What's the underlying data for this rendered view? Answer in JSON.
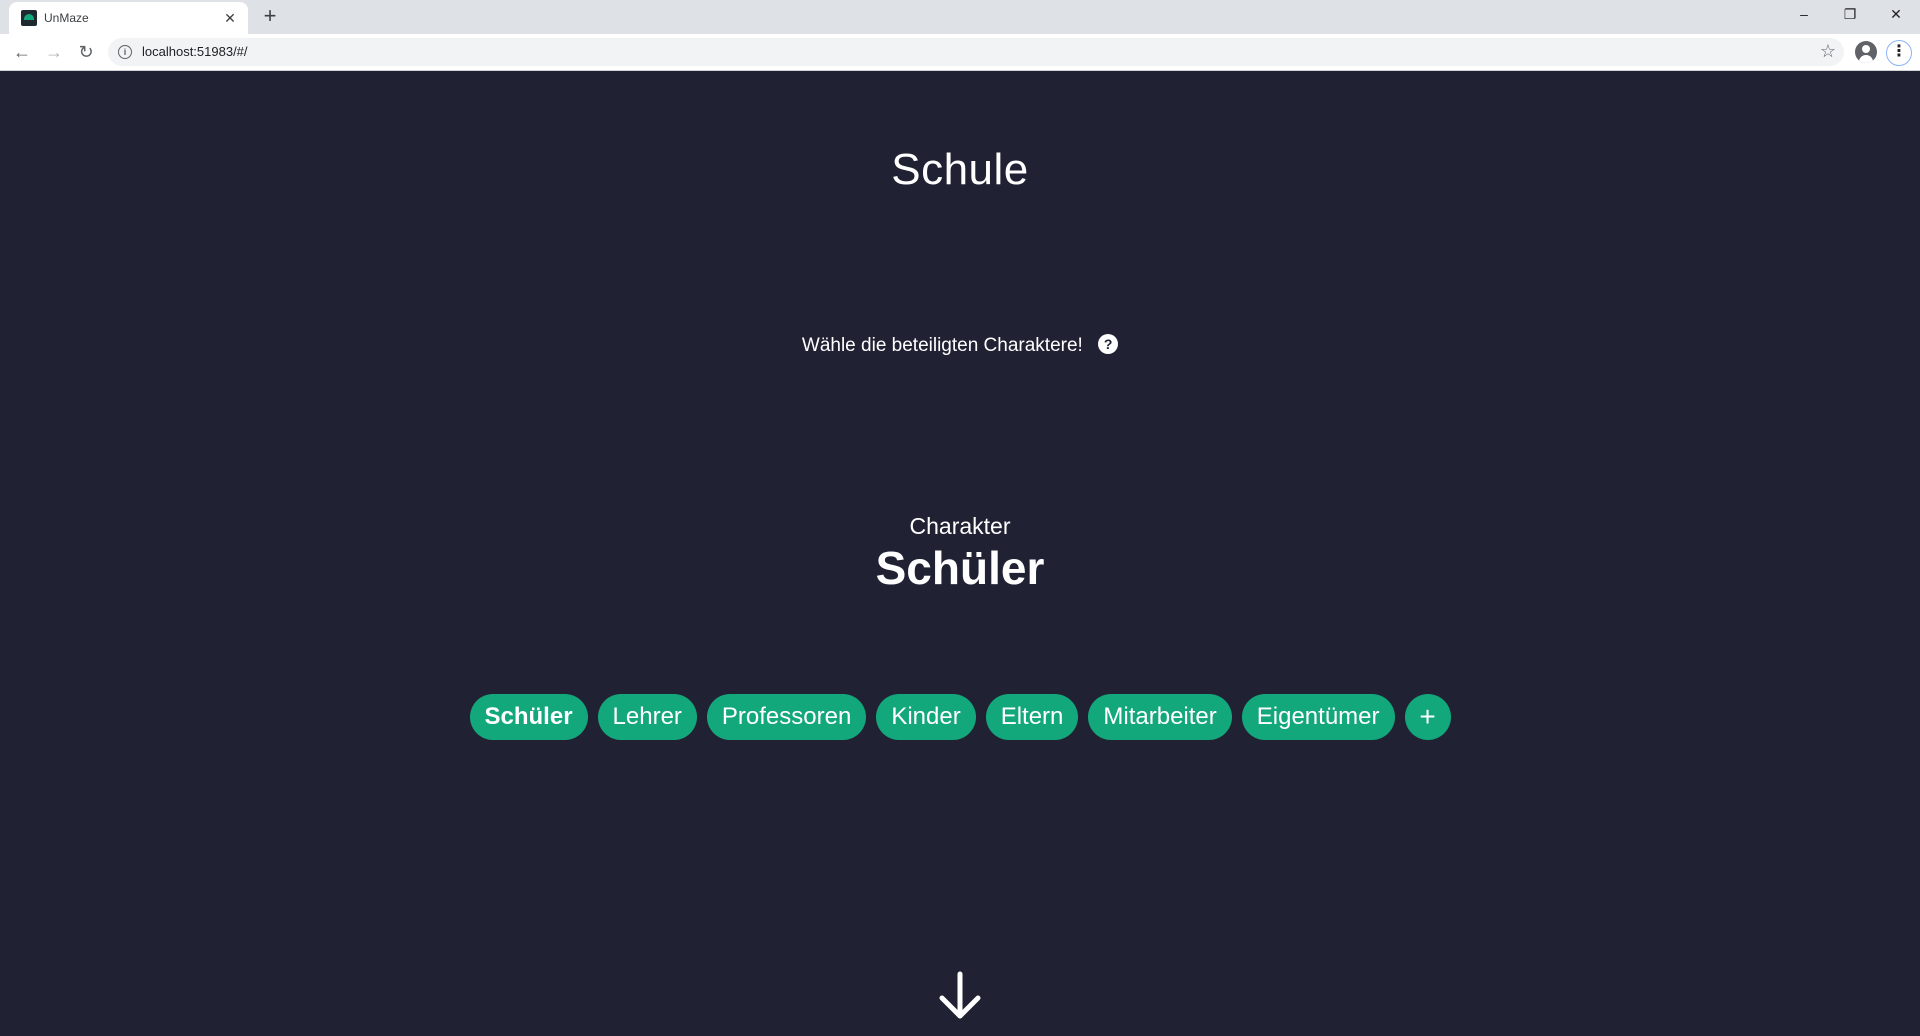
{
  "browser": {
    "tab_title": "UnMaze",
    "tab_close": "✕",
    "new_tab": "+",
    "url": "localhost:51983/#/",
    "controls": {
      "minimize": "–",
      "restore": "❐",
      "close": "✕"
    },
    "nav": {
      "back": "←",
      "forward": "→",
      "reload": "↻"
    },
    "star": "☆",
    "menu": "⋮"
  },
  "page": {
    "title": "Schule",
    "instruction": "Wähle die beteiligten Charaktere!",
    "help": "?",
    "character_label": "Charakter",
    "character_name": "Schüler",
    "characters": [
      "Schüler",
      "Lehrer",
      "Professoren",
      "Kinder",
      "Eltern",
      "Mitarbeiter",
      "Eigentümer"
    ],
    "add_label": "+",
    "accent_color": "#13a87c",
    "background_color": "#202233"
  }
}
